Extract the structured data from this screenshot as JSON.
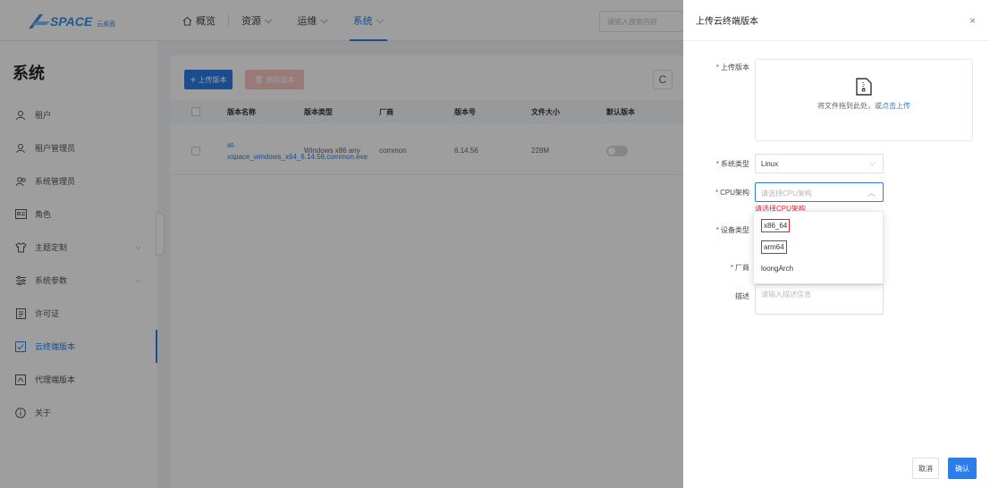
{
  "topbar": {
    "logo_text": "SPACE 云桌面",
    "nav": [
      {
        "label": "概览",
        "icon": "home-icon",
        "has_chevron": false
      },
      {
        "label": "资源",
        "has_chevron": true
      },
      {
        "label": "运维",
        "has_chevron": true
      },
      {
        "label": "系统",
        "has_chevron": true,
        "active": true
      }
    ],
    "search_placeholder": "请输入搜索内容"
  },
  "sidebar": {
    "title": "系统",
    "items": [
      {
        "label": "租户",
        "icon": "user-icon"
      },
      {
        "label": "租户管理员",
        "icon": "user-icon"
      },
      {
        "label": "系统管理员",
        "icon": "users-icon"
      },
      {
        "label": "角色",
        "icon": "id-card-icon"
      },
      {
        "label": "主题定制",
        "icon": "shirt-icon",
        "expandable": true
      },
      {
        "label": "系统参数",
        "icon": "sliders-icon",
        "expandable": true
      },
      {
        "label": "许可证",
        "icon": "document-icon"
      },
      {
        "label": "云终端版本",
        "icon": "cloud-terminal-icon",
        "active": true
      },
      {
        "label": "代理端版本",
        "icon": "proxy-icon"
      },
      {
        "label": "关于",
        "icon": "info-icon"
      }
    ]
  },
  "main": {
    "upload_button": "上传版本",
    "delete_button": "删除版本",
    "columns": [
      "版本名称",
      "版本类型",
      "厂商",
      "版本号",
      "文件大小",
      "默认版本"
    ],
    "rows": [
      {
        "name": "at-xspace_windows_x64_6.14.56.common.exe",
        "type": "Windows x86 any",
        "vendor": "common",
        "version": "6.14.56",
        "size": "228M"
      }
    ]
  },
  "drawer": {
    "title": "上传云终端版本",
    "fields": {
      "upload_label": "上传版本",
      "upload_hint": "将文件拖到此处，或",
      "upload_link": "点击上传",
      "os_label": "系统类型",
      "os_value": "Linux",
      "cpu_label": "CPU架构",
      "cpu_placeholder": "请选择CPU架构",
      "cpu_error": "请选择CPU架构",
      "device_label": "设备类型",
      "vendor_label": "厂商",
      "desc_label": "描述",
      "desc_placeholder": "请输入描述信息"
    },
    "cpu_options": [
      "x86_64",
      "arm64",
      "loongArch"
    ],
    "cancel_button": "取消",
    "confirm_button": "确认"
  }
}
